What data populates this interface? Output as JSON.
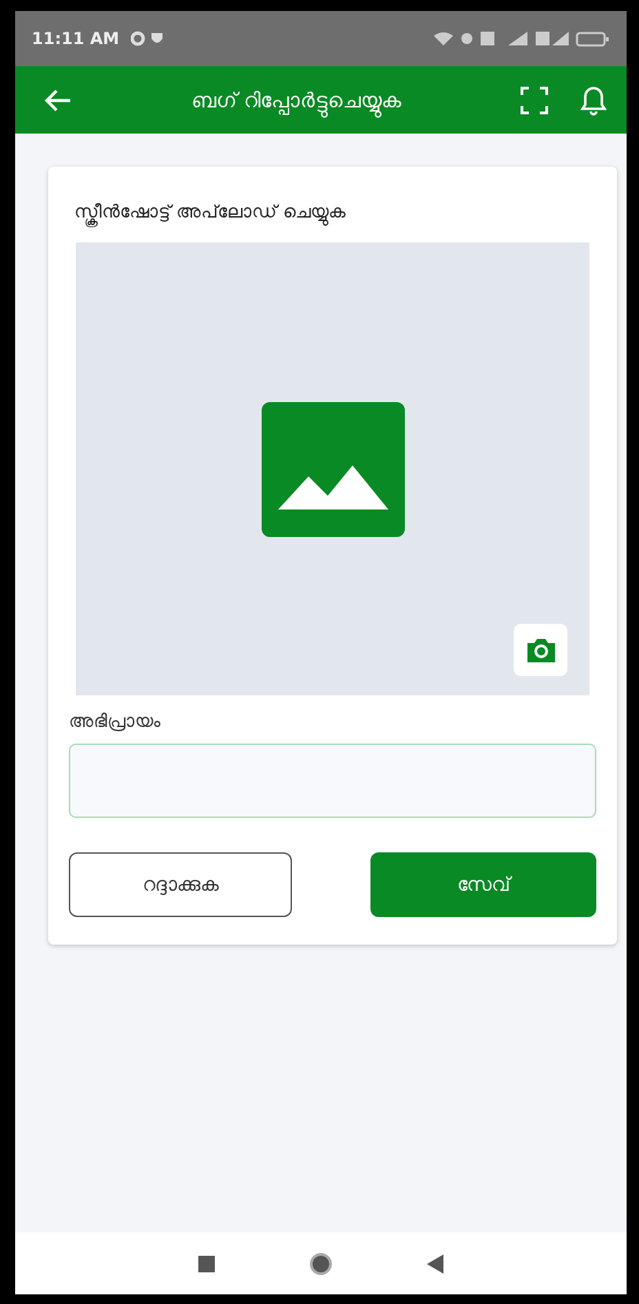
{
  "status_bar": {
    "time": "11:11 AM"
  },
  "app_bar": {
    "title": "ബഗ് റിപ്പോർട്ടുചെയ്യുക"
  },
  "form": {
    "screenshot_label": "സ്ക്രീൻഷോട്ട് അപ്‌ലോഡ് ചെയ്യുക",
    "comment_label": "അഭിപ്രായം",
    "buttons": [
      {
        "label": "റദ്ദാക്കുക",
        "kind": "outline"
      },
      {
        "label": "സേവ്",
        "kind": "primary"
      }
    ]
  }
}
